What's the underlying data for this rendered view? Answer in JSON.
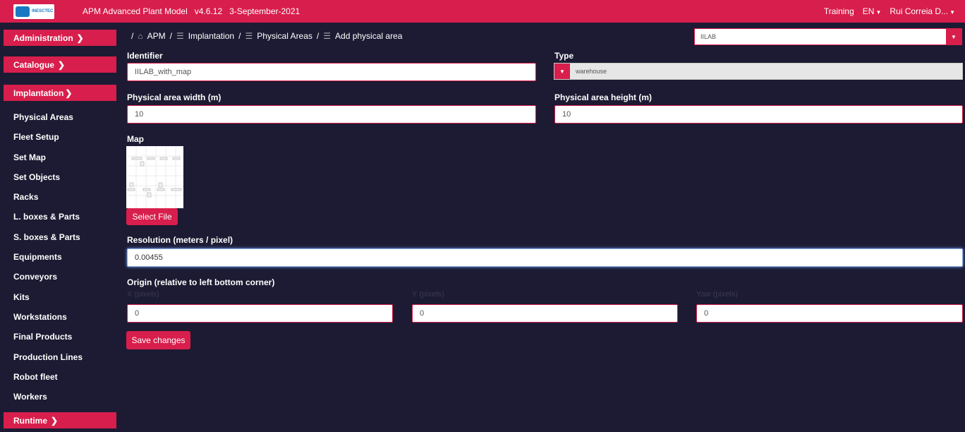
{
  "header": {
    "logo_text": "INESCTEC",
    "app_title": "APM Advanced Plant Model   v4.6.12   3-September-2021",
    "mode": "Training",
    "language": "EN",
    "user": "Rui Correia D...",
    "brand_color": "#d81e4c"
  },
  "sidebar": {
    "sections": {
      "administration": "Administration",
      "catalogue": "Catalogue",
      "implantation": "Implantation",
      "runtime": "Runtime"
    },
    "items": [
      "Physical Areas",
      "Fleet Setup",
      "Set Map",
      "Set Objects",
      "Racks",
      "L. boxes & Parts",
      "S. boxes & Parts",
      "Equipments",
      "Conveyors",
      "Kits",
      "Workstations",
      "Final Products",
      "Production Lines",
      "Robot fleet",
      "Workers"
    ]
  },
  "breadcrumb": {
    "sep": "/",
    "home": "APM",
    "level1": "Implantation",
    "level2": "Physical Areas",
    "level3": "Add physical area"
  },
  "project_select": {
    "value": "IILAB"
  },
  "form": {
    "identifier": {
      "label": "Identifier",
      "value": "IILAB_with_map"
    },
    "type": {
      "label": "Type",
      "value": "warehouse"
    },
    "width": {
      "label": "Physical area width (m)",
      "value": "10"
    },
    "height": {
      "label": "Physical area height (m)",
      "value": "10"
    },
    "map": {
      "label": "Map",
      "select_file": "Select File"
    },
    "resolution": {
      "label": "Resolution (meters / pixel)",
      "value": "0.00455"
    },
    "origin": {
      "label": "Origin (relative to left bottom corner)",
      "x_label": "X (pixels)",
      "x_value": "0",
      "y_label": "Y (pixels)",
      "y_value": "0",
      "yaw_label": "Yaw (pixels)",
      "yaw_value": "0"
    },
    "save": "Save changes"
  }
}
